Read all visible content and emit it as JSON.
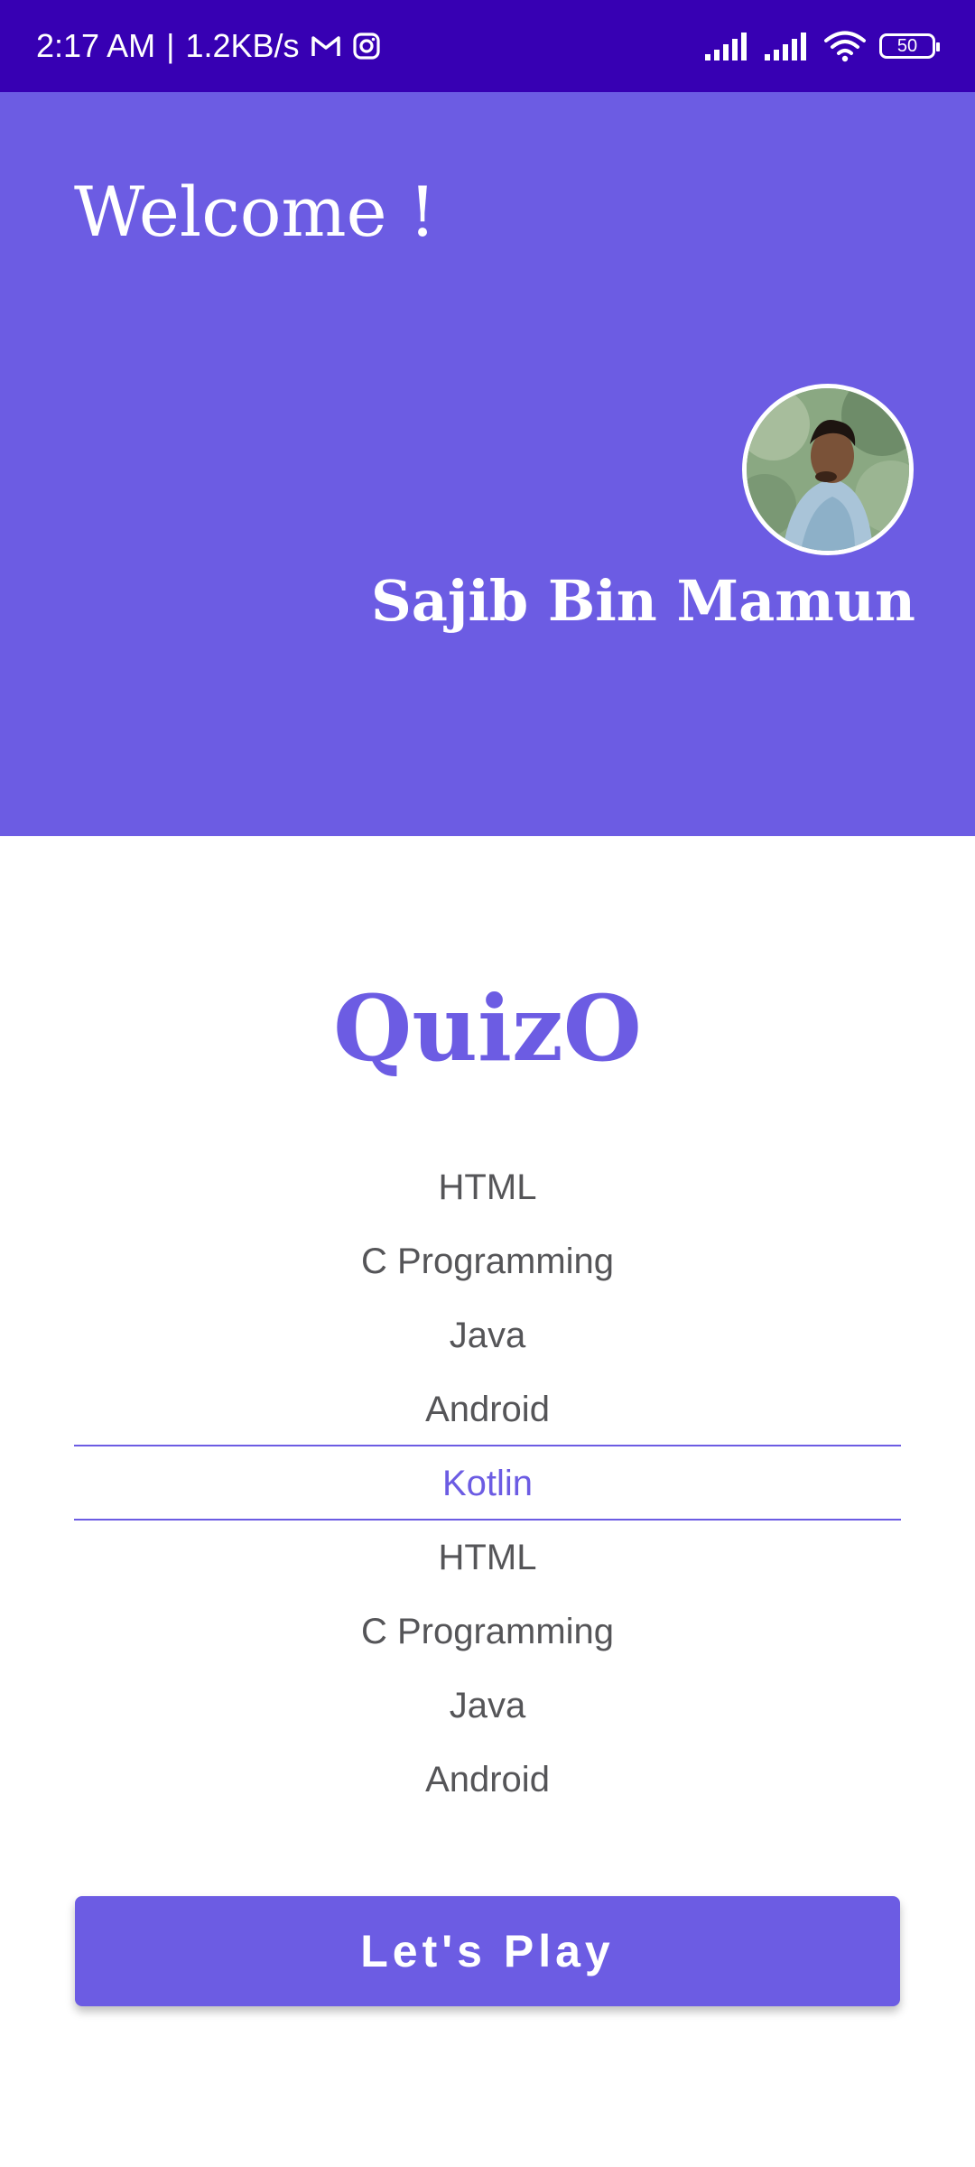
{
  "status_bar": {
    "time": "2:17 AM",
    "separator": "|",
    "speed": "1.2KB/s",
    "battery": "50",
    "left_icons": [
      "gmail-icon",
      "instagram-icon"
    ],
    "right_icons": [
      "signal-icon",
      "signal-icon",
      "wifi-icon",
      "battery-icon"
    ]
  },
  "header": {
    "greeting": "Welcome !",
    "user_name": "Sajib Bin Mamun",
    "background_color": "#6c5ce3"
  },
  "app": {
    "title": "QuizO"
  },
  "picker": {
    "items": [
      "HTML",
      "C Programming",
      "Java",
      "Android",
      "Kotlin",
      "HTML",
      "C Programming",
      "Java",
      "Android"
    ],
    "selected": "Kotlin"
  },
  "actions": {
    "play_label": "Let's Play"
  },
  "colors": {
    "status_bar": "#3700b3",
    "accent": "#6c5ce3",
    "text_muted": "#555558"
  }
}
